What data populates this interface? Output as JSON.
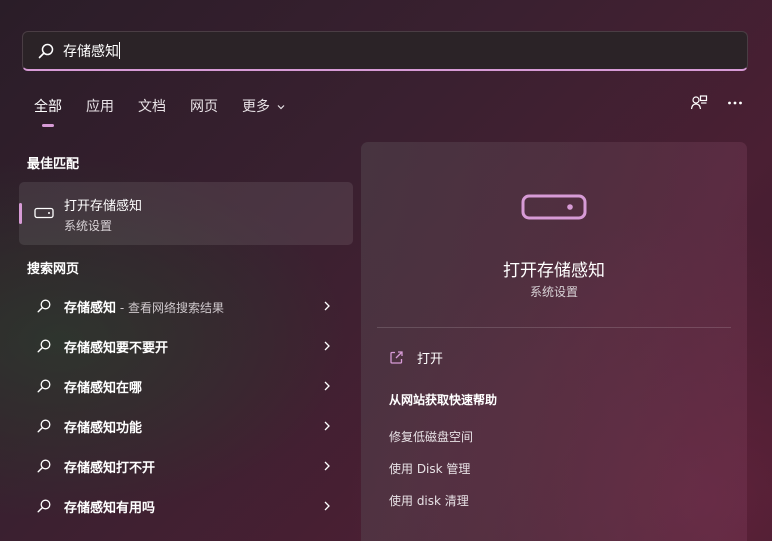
{
  "search": {
    "value": "存储感知",
    "placeholder": ""
  },
  "tabs": [
    {
      "label": "全部",
      "active": true
    },
    {
      "label": "应用"
    },
    {
      "label": "文档"
    },
    {
      "label": "网页"
    },
    {
      "label": "更多"
    }
  ],
  "best_match": {
    "section_title": "最佳匹配",
    "title": "打开存储感知",
    "subtitle": "系统设置"
  },
  "web": {
    "section_title": "搜索网页",
    "results": [
      {
        "query": "存储感知",
        "suffix": " - 查看网络搜索结果"
      },
      {
        "query": "存储感知",
        "bold_suffix": "要不要开"
      },
      {
        "query": "存储感知",
        "bold_suffix": "在哪"
      },
      {
        "query": "存储感知",
        "bold_suffix": "功能"
      },
      {
        "query": "存储感知",
        "bold_suffix": "打不开"
      },
      {
        "query": "存储感知",
        "bold_suffix": "有用吗"
      }
    ]
  },
  "detail": {
    "title": "打开存储感知",
    "subtitle": "系统设置",
    "open_label": "打开",
    "help_title": "从网站获取快速帮助",
    "links": [
      "修复低磁盘空间",
      "使用 Disk 管理",
      "使用 disk 清理"
    ]
  },
  "colors": {
    "accent": "#d79bd6"
  },
  "icons": [
    "search-icon",
    "chevron-down-icon",
    "share-icon",
    "more-icon",
    "drive-icon",
    "chevron-right-icon",
    "open-external-icon"
  ]
}
